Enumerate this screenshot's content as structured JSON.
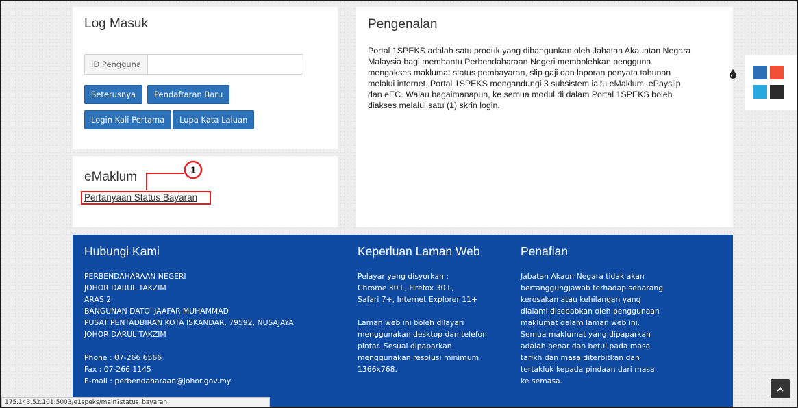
{
  "login": {
    "title": "Log Masuk",
    "user_id_label": "ID Pengguna",
    "user_id_value": "",
    "next_button": "Seterusnya",
    "register_button": "Pendaftaran Baru",
    "first_login_button": "Login Kali Pertama",
    "forgot_password_button": "Lupa Kata Laluan"
  },
  "emaklum": {
    "title": "eMaklum",
    "status_link": "Pertanyaan Status Bayaran",
    "callout_number": "1",
    "callout_color": "#e02020"
  },
  "intro": {
    "title": "Pengenalan",
    "lines": [
      "Portal 1SPEKS adalah satu produk yang dibangunkan oleh Jabatan Akauntan Negara",
      "Malaysia bagi membantu Perbendaharaan Negeri membolehkan pengguna",
      "mengakses maklumat status pembayaran, slip gaji dan laporan penyata tahunan",
      "melalui internet. Portal 1SPEKS mengandungi 3 subsistem iaitu eMaklum, ePayslip",
      "dan eEC. Walau bagaimanapun, ke semua modul di dalam Portal 1SPEKS boleh",
      "diakses melalui satu (1) skrin login."
    ]
  },
  "footer": {
    "background": "#0f4ba3",
    "contact": {
      "title": "Hubungi Kami",
      "address": [
        "PERBENDAHARAAN NEGERI",
        "JOHOR DARUL TAKZIM",
        "ARAS 2",
        "BANGUNAN DATO' JAAFAR MUHAMMAD",
        "PUSAT PENTADBIRAN KOTA ISKANDAR, 79592, NUSAJAYA",
        "JOHOR DARUL TAKZIM"
      ],
      "phone": "Phone : 07-266 6566",
      "fax": "Fax : 07-266 1145",
      "email": "E-mail : perbendaharaan@johor.gov.my"
    },
    "requirements": {
      "title": "Keperluan Laman Web",
      "browsers": [
        "Pelayar yang disyorkan :",
        "Chrome 30+, Firefox 30+,",
        "Safari 7+, Internet Explorer 11+"
      ],
      "device": [
        "Laman web ini boleh dilayari",
        "menggunakan desktop dan telefon",
        "pintar. Sesuai dipaparkan",
        "menggunakan resolusi minimum",
        "1366x768."
      ]
    },
    "disclaimer": {
      "title": "Penafian",
      "lines": [
        "Jabatan Akaun Negara tidak akan",
        "bertanggungjawab terhadap sebarang",
        "kerosakan atau kehilangan yang",
        "dialami disebabkan oleh penggunaan",
        "maklumat dalam laman web ini.",
        "Semua maklumat yang dipaparkan",
        "adalah benar dan betul pada masa",
        "tarikh dan masa diterbitkan dan",
        "tertakluk kepada pindaan dari masa",
        "ke semasa."
      ]
    }
  },
  "theme_swatches": {
    "icon": "water-drop-icon",
    "colors": [
      "#2d6fb5",
      "#f04e37",
      "#29a8e0",
      "#2b2b2b"
    ]
  },
  "status_bar": {
    "url": "175.143.52.101:5003/e1speks/main?status_bayaran"
  },
  "scroll_top": {
    "icon": "chevron-up-icon"
  }
}
